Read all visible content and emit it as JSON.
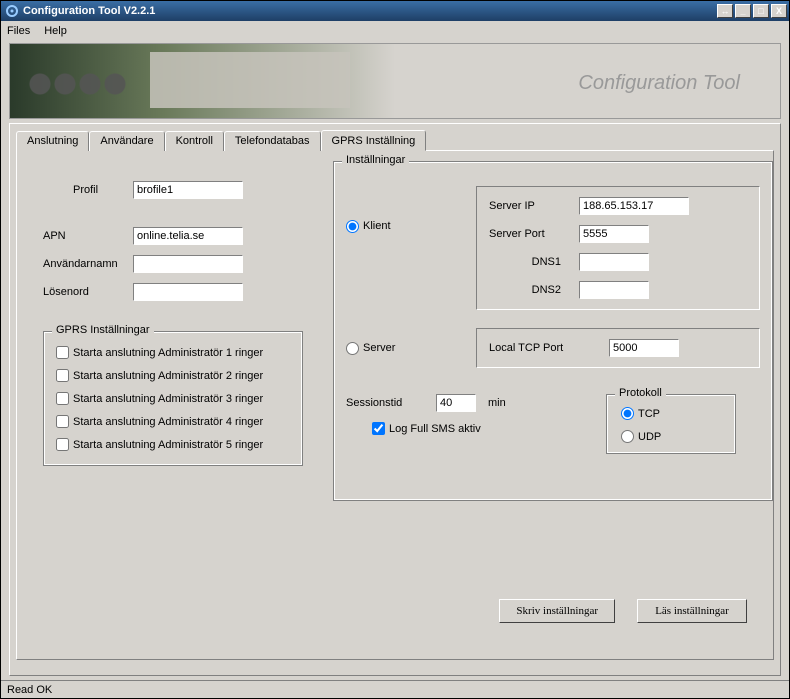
{
  "window": {
    "title": "Configuration Tool  V2.2.1"
  },
  "menu": {
    "files": "Files",
    "help": "Help"
  },
  "banner": {
    "brand": "Configuration Tool"
  },
  "tabs": {
    "anslutning": "Anslutning",
    "anvandare": "Användare",
    "kontroll": "Kontroll",
    "telefondatabas": "Telefondatabas",
    "gprs": "GPRS Inställning"
  },
  "left": {
    "profil_label": "Profil",
    "profil_value": "brofile1",
    "apn_label": "APN",
    "apn_value": "online.telia.se",
    "user_label": "Användarnamn",
    "user_value": "",
    "pass_label": "Lösenord",
    "pass_value": ""
  },
  "gprs_group": {
    "title": "GPRS Inställningar",
    "c1": "Starta anslutning Administratör 1 ringer",
    "c2": "Starta anslutning Administratör 2 ringer",
    "c3": "Starta anslutning Administratör 3 ringer",
    "c4": "Starta anslutning Administratör 4 ringer",
    "c5": "Starta anslutning Administratör 5 ringer"
  },
  "settings": {
    "title": "Inställningar",
    "klient": "Klient",
    "server": "Server",
    "server_ip_label": "Server IP",
    "server_ip_value": "188.65.153.17",
    "server_port_label": "Server Port",
    "server_port_value": "5555",
    "dns1_label": "DNS1",
    "dns1_value": "",
    "dns2_label": "DNS2",
    "dns2_value": "",
    "local_port_label": "Local TCP Port",
    "local_port_value": "5000",
    "session_label": "Sessionstid",
    "session_value": "40",
    "session_unit": "min",
    "log_sms": "Log Full SMS aktiv",
    "protokoll_title": "Protokoll",
    "tcp": "TCP",
    "udp": "UDP"
  },
  "buttons": {
    "write": "Skriv inställningar",
    "read": "Läs inställningar"
  },
  "status": {
    "text": "Read OK"
  },
  "winbtn": {
    "resize": "↔",
    "min": "_",
    "max": "□",
    "close": "X"
  }
}
